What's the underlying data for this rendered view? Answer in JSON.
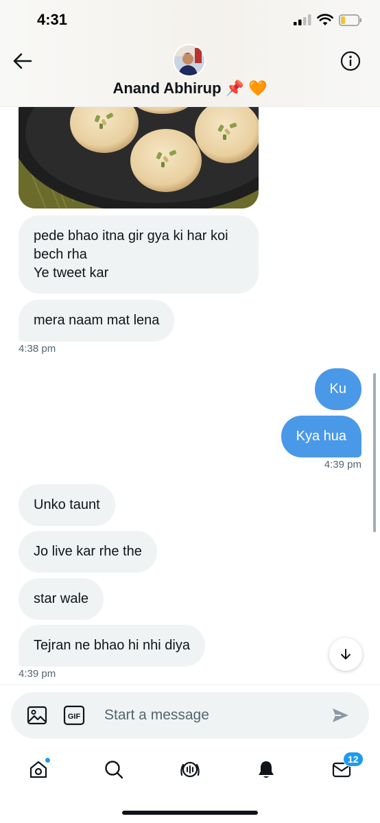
{
  "status_bar": {
    "time": "4:31"
  },
  "header": {
    "contact_name": "Anand Abhirup 📌 🧡"
  },
  "messages": [
    {
      "text": "pede bhao itna gir gya ki har koi\nbech rha\nYe tweet kar",
      "direction": "in"
    },
    {
      "text": "mera naam mat lena",
      "direction": "in"
    },
    {
      "text": "Ku",
      "direction": "out"
    },
    {
      "text": "Kya hua",
      "direction": "out"
    },
    {
      "text": "Unko taunt",
      "direction": "in"
    },
    {
      "text": "Jo live kar rhe the",
      "direction": "in"
    },
    {
      "text": "star wale",
      "direction": "in"
    },
    {
      "text": "Tejran ne bhao hi nhi diya",
      "direction": "in"
    }
  ],
  "timestamps": [
    "4:38 pm",
    "4:39 pm",
    "4:39 pm"
  ],
  "composer": {
    "placeholder": "Start a message",
    "gif_label": "GIF"
  },
  "bottom_nav": {
    "messages_badge": "12"
  },
  "colors": {
    "accent": "#1d9bf0",
    "outgoing_bubble": "#4a99e9",
    "incoming_bubble": "#eff3f4"
  }
}
